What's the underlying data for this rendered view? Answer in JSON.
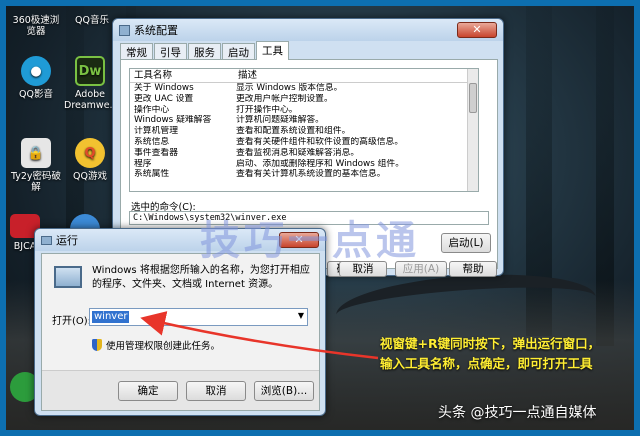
{
  "desktop_icons": [
    {
      "label": "360极速浏览器",
      "icon": "360-browser-icon",
      "color": "#2a7bd6"
    },
    {
      "label": "QQ音乐",
      "icon": "qq-music-icon",
      "color": "#f2c230"
    },
    {
      "label": "QQ影音",
      "icon": "qq-player-icon",
      "color": "#1f9bd6"
    },
    {
      "label": "Adobe Dreamwe...",
      "icon": "dreamweaver-icon",
      "color": "#3f9a2d"
    },
    {
      "label": "Ty2y密码破解",
      "icon": "lock-icon",
      "color": "#2a3f5a"
    },
    {
      "label": "QQ游戏",
      "icon": "qq-game-icon",
      "color": "#e34b2a"
    },
    {
      "label": "BJCA",
      "icon": "bjca-icon",
      "color": "#c8202a"
    }
  ],
  "msconfig": {
    "title": "系统配置",
    "close": "✕",
    "tabs": [
      "常规",
      "引导",
      "服务",
      "启动",
      "工具"
    ],
    "active_tab": "工具",
    "columns": [
      "工具名称",
      "描述"
    ],
    "rows": [
      {
        "name": "关于 Windows",
        "desc": "显示 Windows 版本信息。"
      },
      {
        "name": "更改 UAC 设置",
        "desc": "更改用户帐户控制设置。"
      },
      {
        "name": "操作中心",
        "desc": "打开操作中心。"
      },
      {
        "name": "Windows 疑难解答",
        "desc": "计算机问题疑难解答。"
      },
      {
        "name": "计算机管理",
        "desc": "查看和配置系统设置和组件。"
      },
      {
        "name": "系统信息",
        "desc": "查看有关硬件组件和软件设置的高级信息。"
      },
      {
        "name": "事件查看器",
        "desc": "查看监视消息和疑难解答消息。"
      },
      {
        "name": "程序",
        "desc": "启动、添加或删除程序和 Windows 组件。"
      },
      {
        "name": "系统属性",
        "desc": "查看有关计算机系统设置的基本信息。"
      }
    ],
    "selected_command_label": "选中的命令(C):",
    "selected_command": "C:\\Windows\\system32\\winver.exe",
    "launch": "启动(L)",
    "ok": "确定",
    "cancel": "取消",
    "apply": "应用(A)",
    "help": "帮助"
  },
  "run": {
    "title": "运行",
    "close": "✕",
    "description": "Windows 将根据您所输入的名称，为您打开相应的程序、文件夹、文档或 Internet 资源。",
    "open_label": "打开(O):",
    "open_value": "winver",
    "admin_text": "使用管理权限创建此任务。",
    "ok": "确定",
    "cancel": "取消",
    "browse": "浏览(B)..."
  },
  "watermark": "技巧一点通",
  "annotation": [
    "视窗键+R键同时按下，弹出运行窗口，",
    "输入工具名称，点确定，即可打开工具"
  ],
  "brand": "头条 @技巧一点通自媒体",
  "colors": {
    "accent_arrow": "#e8352a",
    "annotation": "#ffee33",
    "selection": "#3172cf"
  }
}
